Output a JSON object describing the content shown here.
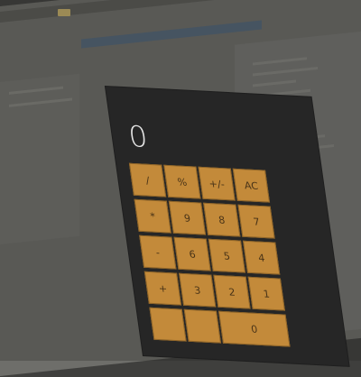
{
  "calculator": {
    "display_value": "0",
    "keys": {
      "divide": "/",
      "percent": "%",
      "sign": "+/-",
      "clear": "AC",
      "multiply": "*",
      "nine": "9",
      "eight": "8",
      "seven": "7",
      "minus": "-",
      "six": "6",
      "five": "5",
      "four": "4",
      "plus": "+",
      "three": "3",
      "two": "2",
      "one": "1",
      "zero": "0"
    }
  },
  "colors": {
    "calculator_body": "#262626",
    "key_fill": "#c38a3a",
    "display_text": "#e6e6e6"
  }
}
